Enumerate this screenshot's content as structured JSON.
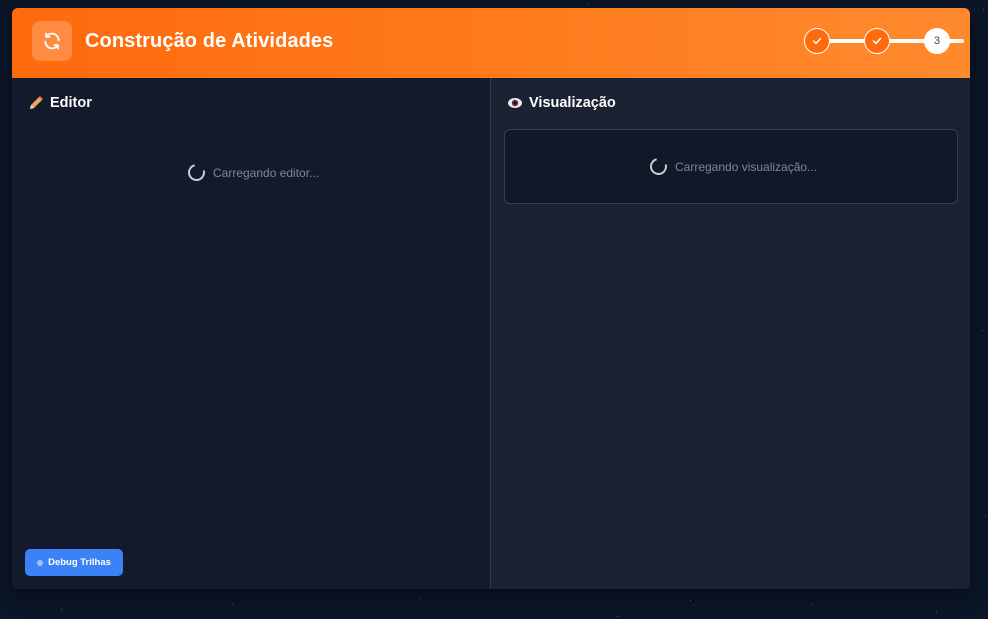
{
  "header": {
    "title": "Construção de Atividades",
    "logo_icon": "refresh-icon",
    "accent": "#ff6a0d",
    "steps": [
      {
        "state": "done",
        "icon": "check-icon"
      },
      {
        "state": "done",
        "icon": "check-icon"
      },
      {
        "state": "current",
        "label": "3"
      }
    ]
  },
  "editor": {
    "heading": "Editor",
    "heading_icon": "pencil-icon",
    "loading_text": "Carregando editor..."
  },
  "preview": {
    "heading": "Visualização",
    "heading_icon": "eye-icon",
    "loading_text": "Carregando visualização..."
  },
  "debug": {
    "label": "Debug Trilhas",
    "color": "#3b82f6"
  }
}
